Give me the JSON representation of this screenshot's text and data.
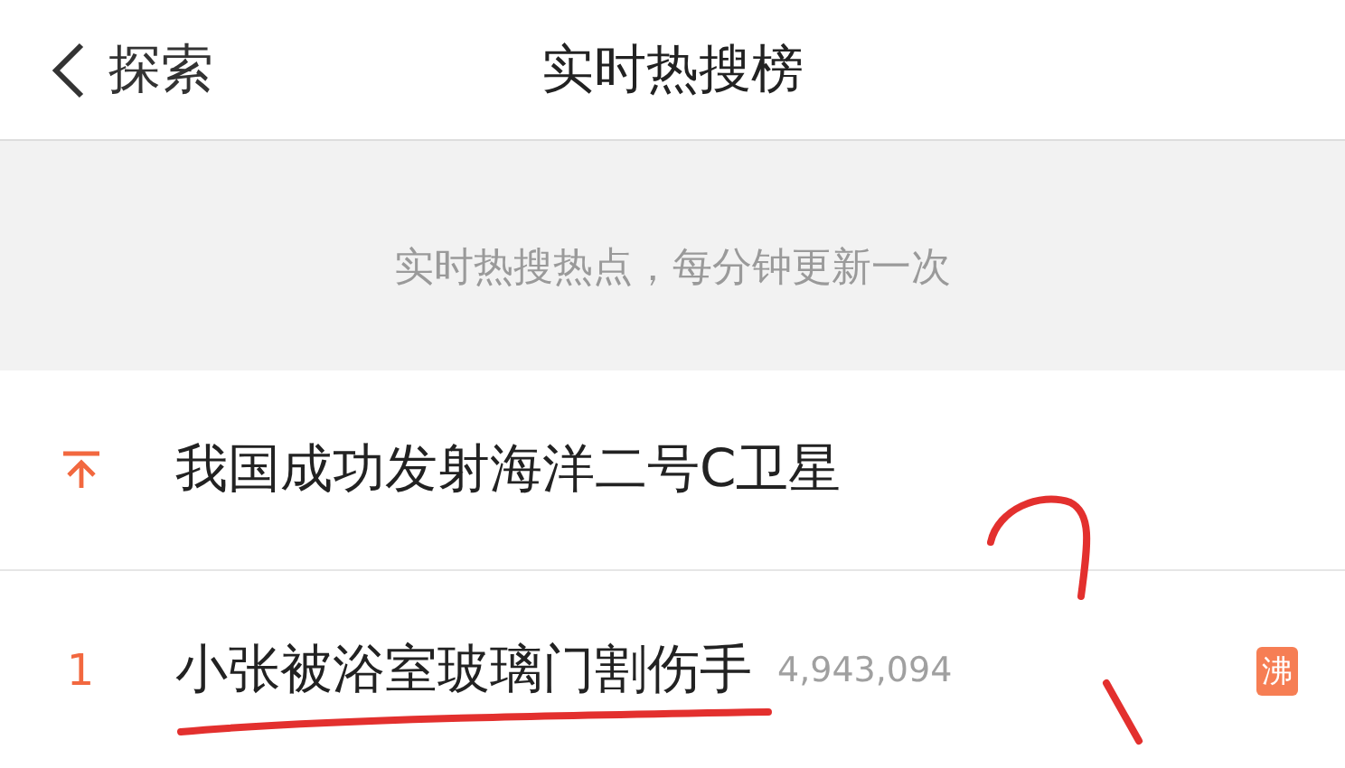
{
  "header": {
    "back_label": "探索",
    "title": "实时热搜榜"
  },
  "notice": "实时热搜热点，每分钟更新一次",
  "items": [
    {
      "kind": "pinned",
      "title": "我国成功发射海洋二号C卫星"
    },
    {
      "kind": "ranked",
      "rank": "1",
      "title": "小张被浴室玻璃门割伤手",
      "count": "4,943,094",
      "badge": "沸"
    }
  ]
}
